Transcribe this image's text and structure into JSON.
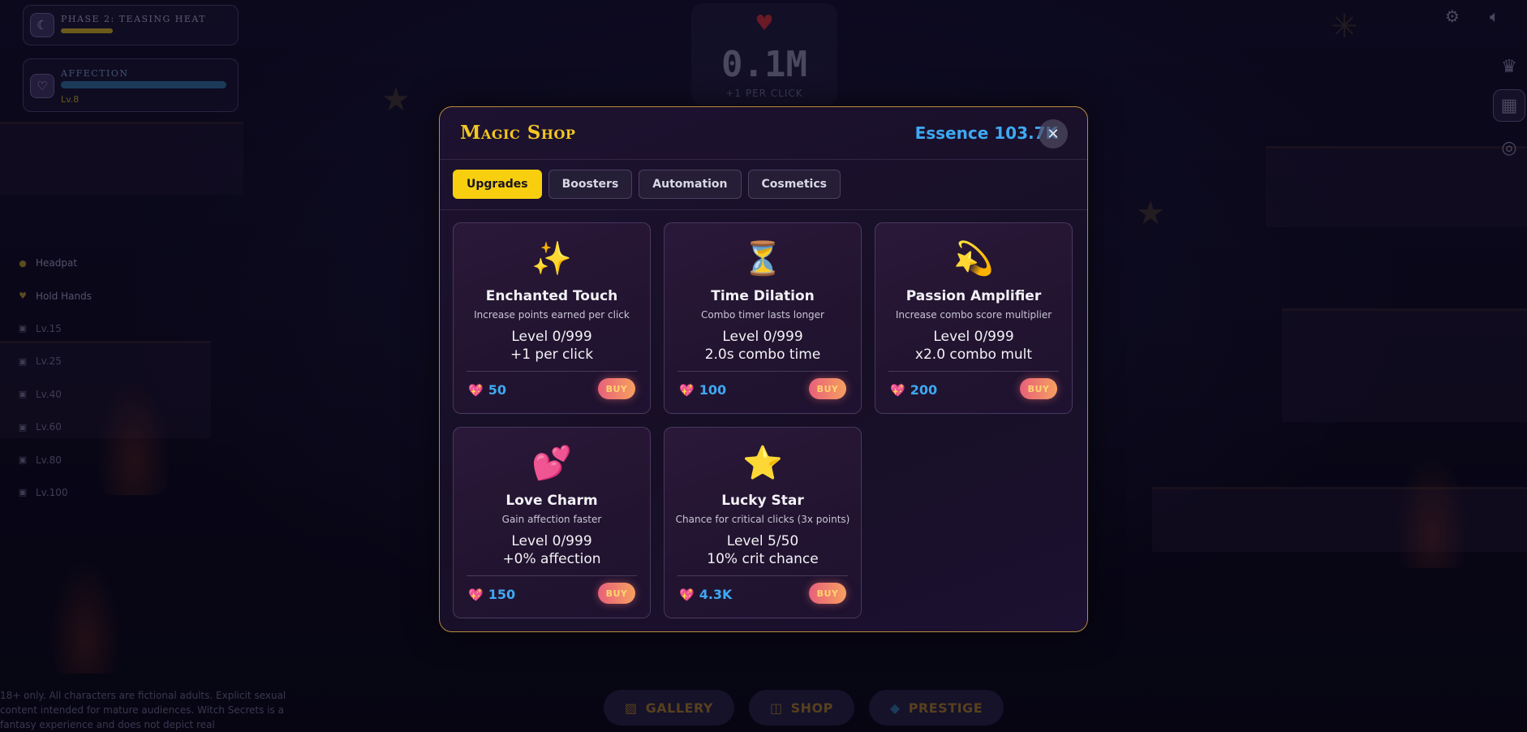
{
  "hud": {
    "phase_title": "PHASE 2: TEASING HEAT",
    "affection_title": "AFFECTION",
    "affection_level": "Lv.8"
  },
  "left_menu": [
    {
      "label": "Headpat",
      "locked": false
    },
    {
      "label": "Hold Hands",
      "locked": false
    },
    {
      "label": "Lv.15",
      "locked": true
    },
    {
      "label": "Lv.25",
      "locked": true
    },
    {
      "label": "Lv.40",
      "locked": true
    },
    {
      "label": "Lv.60",
      "locked": true
    },
    {
      "label": "Lv.80",
      "locked": true
    },
    {
      "label": "Lv.100",
      "locked": true
    }
  ],
  "counter": {
    "value": "0.1M",
    "per_click": "+1 PER CLICK"
  },
  "bottom_nav": {
    "gallery": "GALLERY",
    "shop": "SHOP",
    "prestige": "PRESTIGE"
  },
  "disclaimer": "18+ only. All characters are fictional adults. Explicit sexual content intended for mature audiences. Witch Secrets is a fantasy experience and does not depict real",
  "shop": {
    "title": "Magic Shop",
    "essence_label": "Essence 103.7K",
    "close_symbol": "✕",
    "tabs": [
      {
        "label": "Upgrades",
        "active": true
      },
      {
        "label": "Boosters",
        "active": false
      },
      {
        "label": "Automation",
        "active": false
      },
      {
        "label": "Cosmetics",
        "active": false
      }
    ],
    "buy_label": "BUY",
    "items": [
      {
        "icon": "sparkles-icon",
        "emoji": "✨",
        "name": "Enchanted Touch",
        "desc": "Increase points earned per click",
        "level": "Level 0/999",
        "effect": "+1 per click",
        "cost": "50"
      },
      {
        "icon": "hourglass-icon",
        "emoji": "⏳",
        "name": "Time Dilation",
        "desc": "Combo timer lasts longer",
        "level": "Level 0/999",
        "effect": "2.0s combo time",
        "cost": "100"
      },
      {
        "icon": "dizzy-star-icon",
        "emoji": "💫",
        "name": "Passion Amplifier",
        "desc": "Increase combo score multiplier",
        "level": "Level 0/999",
        "effect": "x2.0 combo mult",
        "cost": "200"
      },
      {
        "icon": "two-hearts-icon",
        "emoji": "💕",
        "name": "Love Charm",
        "desc": "Gain affection faster",
        "level": "Level 0/999",
        "effect": "+0% affection",
        "cost": "150"
      },
      {
        "icon": "star-icon",
        "emoji": "⭐",
        "name": "Lucky Star",
        "desc": "Chance for critical clicks (3x points)",
        "level": "Level 5/50",
        "effect": "10% crit chance",
        "cost": "4.3K"
      }
    ]
  },
  "colors": {
    "accent_gold": "#f7cf0f",
    "essence_blue": "#3fa8f2",
    "modal_border": "#b98a3c",
    "buy_gradient_start": "#e8607a",
    "buy_gradient_end": "#f6a060"
  }
}
